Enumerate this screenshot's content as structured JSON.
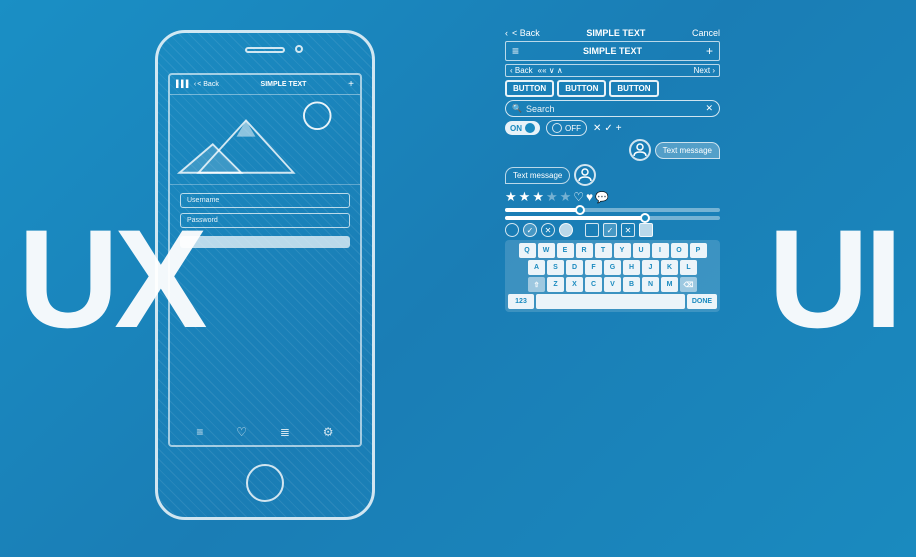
{
  "background": {
    "color": "#1a8abf"
  },
  "left_text": {
    "label": "UX"
  },
  "right_text": {
    "label": "UI"
  },
  "phone": {
    "title": "SIMPLE TEXT",
    "back_label": "< Back",
    "plus_label": "+",
    "username_placeholder": "Username",
    "password_placeholder": "Password",
    "signal": "▌▌▌",
    "battery": "▬"
  },
  "ui_panel": {
    "header": {
      "back": "< Back",
      "title": "SIMPLE TEXT",
      "cancel": "Cancel"
    },
    "menu": {
      "icon": "≡",
      "title": "SIMPLE TEXT",
      "plus": "+"
    },
    "breadcrumb": {
      "back": "< Back",
      "chevrons": "<< ∨ ∧ >",
      "next": "Next >"
    },
    "buttons": [
      "BUTTON",
      "BUTTON",
      "BUTTON"
    ],
    "search": {
      "placeholder": "Search",
      "icon": "🔍",
      "clear": "✕"
    },
    "toggles": {
      "on_label": "ON",
      "off_label": "OFF",
      "icons": [
        "✕",
        "✓",
        "+"
      ]
    },
    "chat": {
      "sent_text": "Text message",
      "received_text": "Text message"
    },
    "stars": {
      "filled": 3,
      "empty": 2
    },
    "keyboard": {
      "rows": [
        [
          "Q",
          "W",
          "E",
          "R",
          "T",
          "Y",
          "U",
          "I",
          "O",
          "P"
        ],
        [
          "A",
          "S",
          "D",
          "F",
          "G",
          "H",
          "J",
          "K",
          "L"
        ],
        [
          "⇧",
          "Z",
          "X",
          "C",
          "V",
          "B",
          "N",
          "M",
          "⌫"
        ],
        [
          "123",
          " ",
          "DONE"
        ]
      ]
    }
  }
}
